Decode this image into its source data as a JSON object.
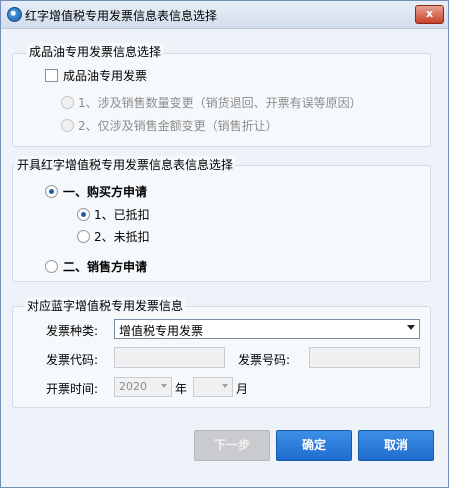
{
  "window": {
    "title": "红字增值税专用发票信息表信息选择",
    "close_label": "x"
  },
  "oil_group": {
    "legend": "成品油专用发票信息选择",
    "checkbox_label": "成品油专用发票",
    "options": [
      "1、涉及销售数量变更（销货退回、开票有误等原因）",
      "2、仅涉及销售金额变更（销售折让）"
    ]
  },
  "issue_group": {
    "legend": "开具红字增值税专用发票信息表信息选择",
    "buyer_label": "一、购买方申请",
    "sub_options": [
      "1、已抵扣",
      "2、未抵扣"
    ],
    "seller_label": "二、销售方申请"
  },
  "blue_group": {
    "legend": "对应蓝字增值税专用发票信息",
    "invoice_type_label": "发票种类:",
    "invoice_type_value": "增值税专用发票",
    "invoice_code_label": "发票代码:",
    "invoice_number_label": "发票号码:",
    "issue_time_label": "开票时间:",
    "year_value": "2020",
    "year_unit": "年",
    "month_value": "",
    "month_unit": "月"
  },
  "buttons": {
    "next": "下一步",
    "confirm": "确定",
    "cancel": "取消"
  },
  "colors": {
    "primary_button": "#2a7ad9",
    "disabled_button": "#c9cbce",
    "window_bg": "#eef3f9"
  }
}
